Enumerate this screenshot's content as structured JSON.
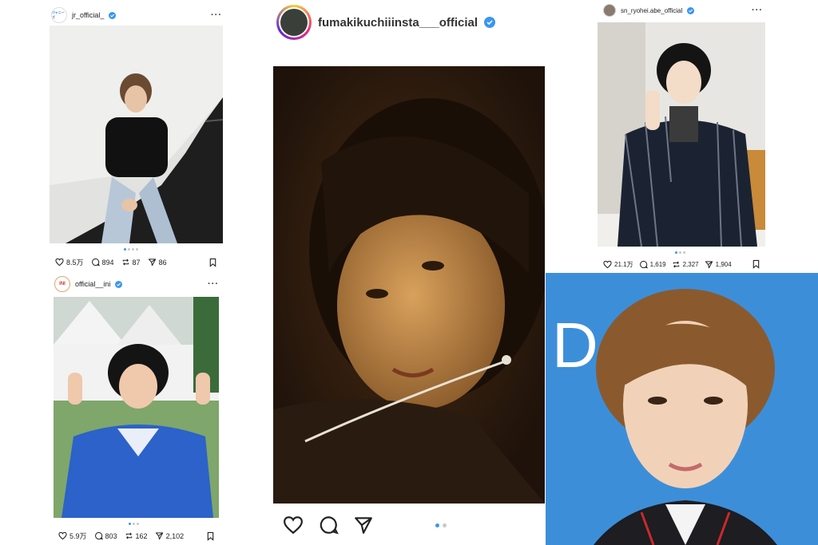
{
  "posts": {
    "top_left": {
      "avatar_text": "ジャニーズ",
      "username": "jr_official_",
      "likes": "8.5万",
      "comments": "894",
      "reposts": "87",
      "shares": "86"
    },
    "bottom_left": {
      "avatar_text": "INI",
      "username": "official__ini",
      "likes": "5.9万",
      "comments": "803",
      "reposts": "162",
      "shares": "2,102"
    },
    "center": {
      "username": "fumakikuchiiinsta___official"
    },
    "top_right": {
      "username": "sn_ryohei.abe_official",
      "likes": "21.1万",
      "comments": "1,619",
      "reposts": "2,327",
      "shares": "1,904"
    },
    "bottom_right": {
      "backdrop_letter": "D"
    }
  },
  "icons": {
    "like": "heart-icon",
    "comment": "comment-icon",
    "repost": "repost-icon",
    "share": "send-icon",
    "save": "bookmark-icon",
    "more": "more-icon",
    "verified": "verified-badge-icon"
  },
  "colors": {
    "verified": "#3897f0",
    "dot_active": "#3897f0",
    "dot_inactive": "#c8c8c8",
    "photo_center_dark": "#2a1a0e",
    "photo_right_blue": "#3d8ed9"
  }
}
